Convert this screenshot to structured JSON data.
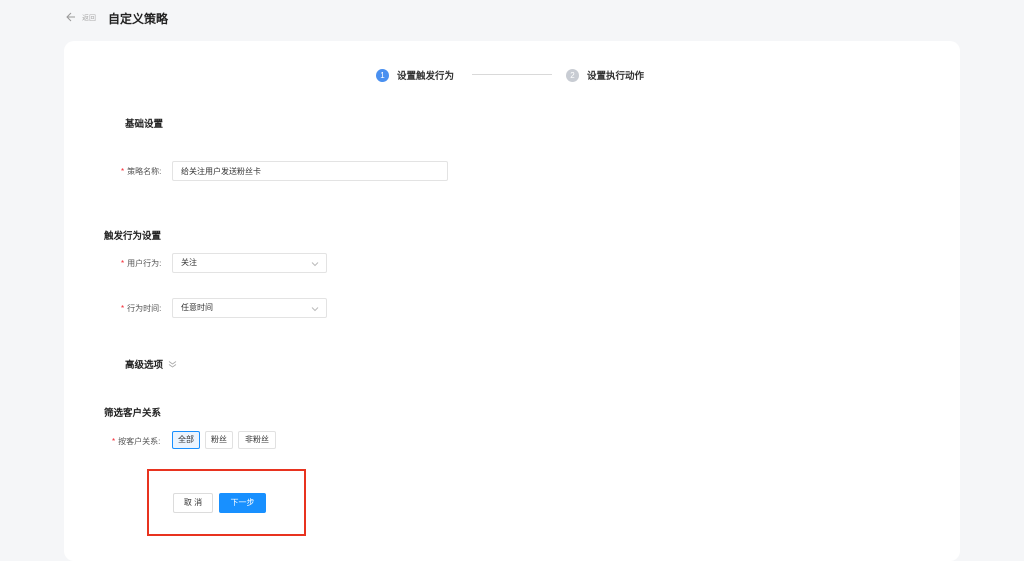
{
  "header": {
    "back_label": "返回",
    "title": "自定义策略"
  },
  "steps": [
    {
      "num": "1",
      "label": "设置触发行为"
    },
    {
      "num": "2",
      "label": "设置执行动作"
    }
  ],
  "basic": {
    "section_title": "基础设置",
    "name_label": "策略名称:",
    "name_value": "给关注用户发送粉丝卡"
  },
  "trigger": {
    "section_title": "触发行为设置",
    "behavior_label": "用户行为:",
    "behavior_value": "关注",
    "time_label": "行为时间:",
    "time_value": "任意时间"
  },
  "advanced": {
    "label": "高级选项"
  },
  "filter": {
    "section_title": "筛选客户关系",
    "relation_label": "按客户关系:",
    "options": [
      "全部",
      "粉丝",
      "非粉丝"
    ],
    "selected": "全部"
  },
  "actions": {
    "cancel": "取 消",
    "next": "下一步"
  },
  "colors": {
    "primary": "#1890ff",
    "step_active": "#4a90f0",
    "step_inactive": "#c8ccd3",
    "required": "#f5222d",
    "highlight": "#e8331f"
  },
  "required_mark": "*"
}
